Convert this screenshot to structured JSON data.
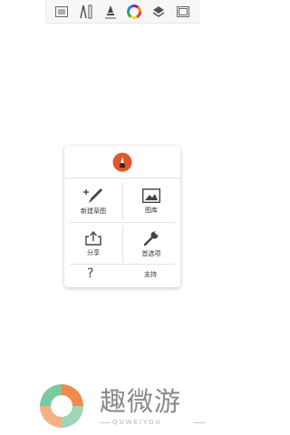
{
  "toolbar": {
    "icons": [
      "list-icon",
      "ruler-compass-icon",
      "brush-icon",
      "color-wheel-icon",
      "layers-icon",
      "canvas-frame-icon"
    ]
  },
  "menu": {
    "logo_icon": "sketch-app-logo-icon",
    "items": [
      {
        "label": "新建草图",
        "icon": "new-sketch-icon"
      },
      {
        "label": "图库",
        "icon": "gallery-icon"
      },
      {
        "label": "分享",
        "icon": "share-icon"
      },
      {
        "label": "首选项",
        "icon": "wrench-icon"
      }
    ],
    "help_symbol": "?",
    "support_label": "支持"
  },
  "watermark": {
    "brand": "趣微游",
    "subtitle": "QUWEIYOU",
    "colors": {
      "orange": "#F08A4B",
      "green": "#7CC8A0",
      "gray": "#8a8a8a"
    }
  },
  "colors": {
    "logo_orange": "#E2562C",
    "card_border": "#e3e3e3"
  }
}
